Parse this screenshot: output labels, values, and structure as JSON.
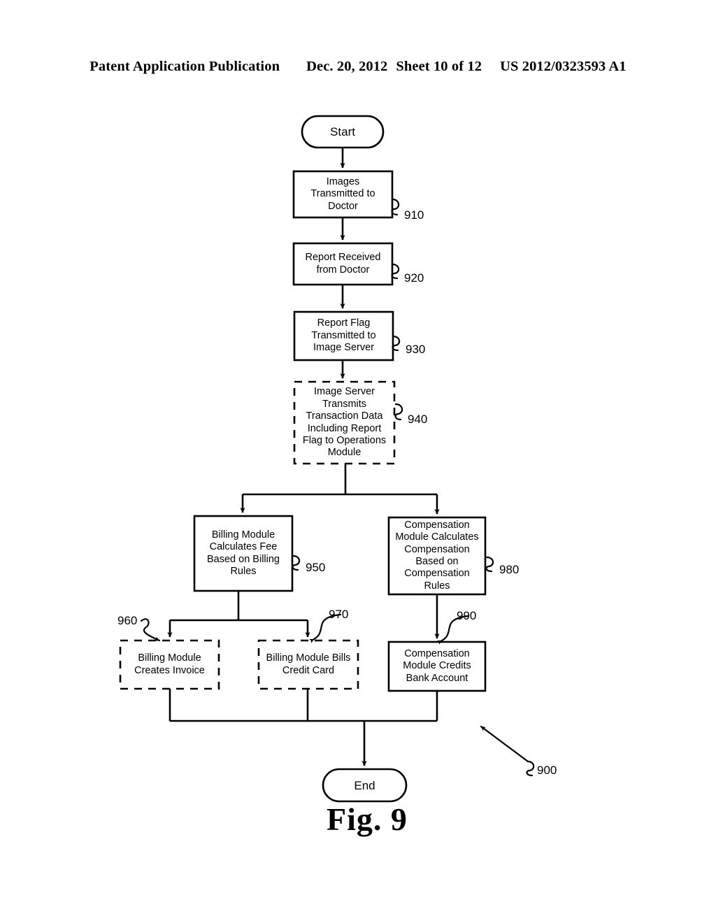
{
  "header": {
    "publication": "Patent Application Publication",
    "date": "Dec. 20, 2012",
    "sheet": "Sheet 10 of 12",
    "patent_number": "US 2012/0323593 A1"
  },
  "figure": {
    "caption": "Fig. 9",
    "overall_ref": "900"
  },
  "nodes": {
    "start": {
      "label": "Start",
      "shape": "terminal"
    },
    "step_910": {
      "label": "Images\nTransmitted to\nDoctor",
      "ref": "910",
      "shape": "process-solid"
    },
    "step_920": {
      "label": "Report Received\nfrom Doctor",
      "ref": "920",
      "shape": "process-solid"
    },
    "step_930": {
      "label": "Report Flag\nTransmitted to\nImage Server",
      "ref": "930",
      "shape": "process-solid"
    },
    "step_940": {
      "label": "Image Server\nTransmits\nTransaction Data\nIncluding Report\nFlag to Operations\nModule",
      "ref": "940",
      "shape": "process-dashed"
    },
    "step_950": {
      "label": "Billing Module\nCalculates Fee\nBased on Billing\nRules",
      "ref": "950",
      "shape": "process-solid"
    },
    "step_960": {
      "label": "Billing Module\nCreates Invoice",
      "ref": "960",
      "shape": "process-dashed"
    },
    "step_970": {
      "label": "Billing Module Bills\nCredit Card",
      "ref": "970",
      "shape": "process-dashed"
    },
    "step_980": {
      "label": "Compensation\nModule Calculates\nCompensation\nBased on\nCompensation\nRules",
      "ref": "980",
      "shape": "process-solid"
    },
    "step_990": {
      "label": "Compensation\nModule Credits\nBank Account",
      "ref": "990",
      "shape": "process-solid"
    },
    "end": {
      "label": "End",
      "shape": "terminal"
    }
  },
  "colors": {
    "ink": "#000000",
    "paper": "#ffffff"
  }
}
